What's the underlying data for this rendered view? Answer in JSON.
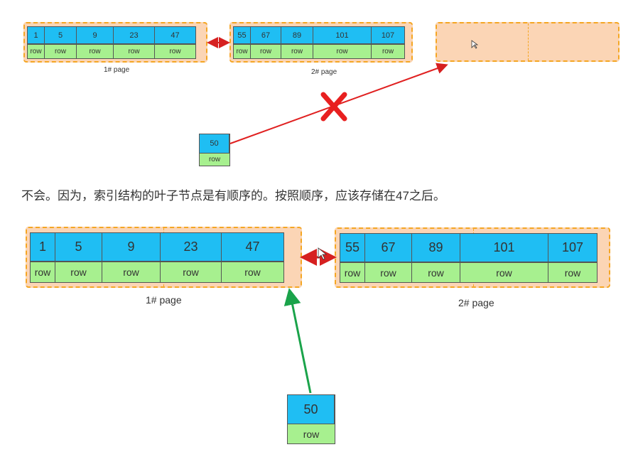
{
  "top": {
    "page1": {
      "keys": [
        "1",
        "5",
        "9",
        "23",
        "47"
      ],
      "rows": [
        "row",
        "row",
        "row",
        "row",
        "row"
      ],
      "caption": "1#  page"
    },
    "page2": {
      "keys": [
        "55",
        "67",
        "89",
        "101",
        "107"
      ],
      "rows": [
        "row",
        "row",
        "row",
        "row",
        "row"
      ],
      "caption": "2#  page"
    },
    "new_record": {
      "key": "50",
      "row": "row"
    }
  },
  "explanation": "不会。因为，索引结构的叶子节点是有顺序的。按照顺序，应该存储在47之后。",
  "bottom": {
    "page1": {
      "keys": [
        "1",
        "5",
        "9",
        "23",
        "47"
      ],
      "rows": [
        "row",
        "row",
        "row",
        "row",
        "row"
      ],
      "caption": "1#  page"
    },
    "page2": {
      "keys": [
        "55",
        "67",
        "89",
        "101",
        "107"
      ],
      "rows": [
        "row",
        "row",
        "row",
        "row",
        "row"
      ],
      "caption": "2#  page"
    },
    "new_record": {
      "key": "50",
      "row": "row"
    }
  },
  "colors": {
    "key_cell": "#1fbef3",
    "row_cell": "#a7f08f",
    "page_bg": "#fbd5b5",
    "page_border": "#f5a623",
    "wrong_arrow": "#e02020",
    "right_arrow": "#1aa34a",
    "link_arrow": "#d62020"
  }
}
